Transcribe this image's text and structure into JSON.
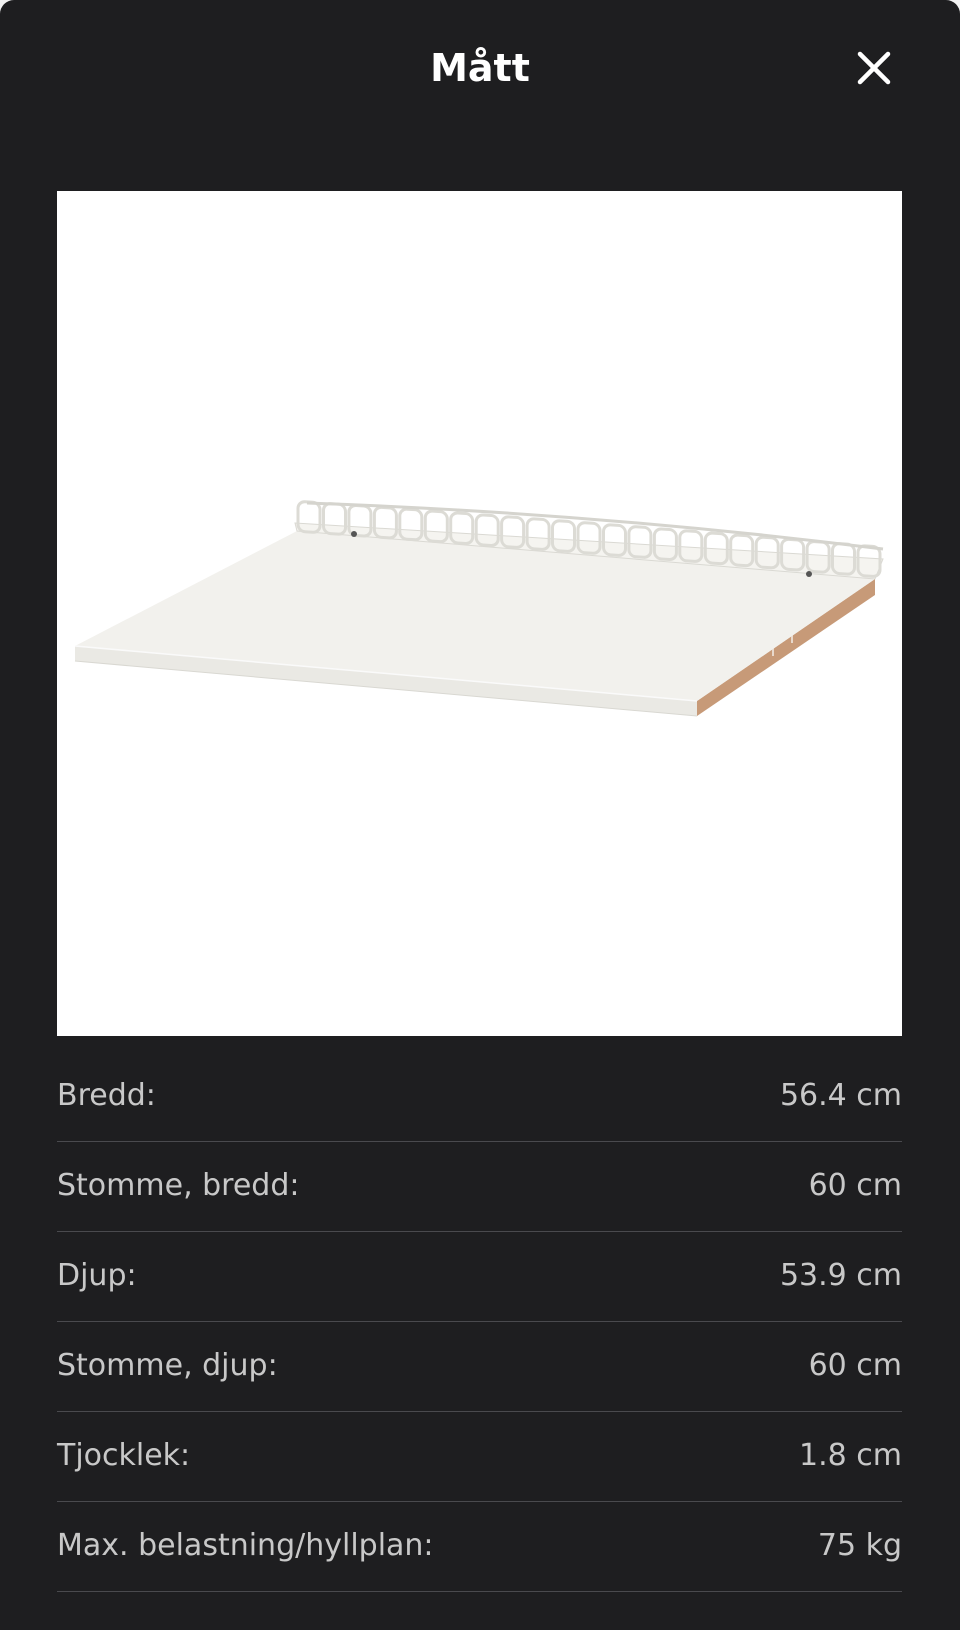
{
  "header": {
    "title": "Mått",
    "close_icon": "close-icon"
  },
  "product_image": {
    "subject": "shelf-with-wire-rail"
  },
  "dimensions": [
    {
      "label": "Bredd:",
      "value": "56.4 cm"
    },
    {
      "label": "Stomme, bredd:",
      "value": "60 cm"
    },
    {
      "label": "Djup:",
      "value": "53.9 cm"
    },
    {
      "label": "Stomme, djup:",
      "value": "60 cm"
    },
    {
      "label": "Tjocklek:",
      "value": "1.8 cm"
    },
    {
      "label": "Max. belastning/hyllplan:",
      "value": "75 kg"
    }
  ],
  "colors": {
    "background": "#1e1e20",
    "title": "#ffffff",
    "text": "#c8c8c8",
    "divider": "#4a4a4e"
  }
}
